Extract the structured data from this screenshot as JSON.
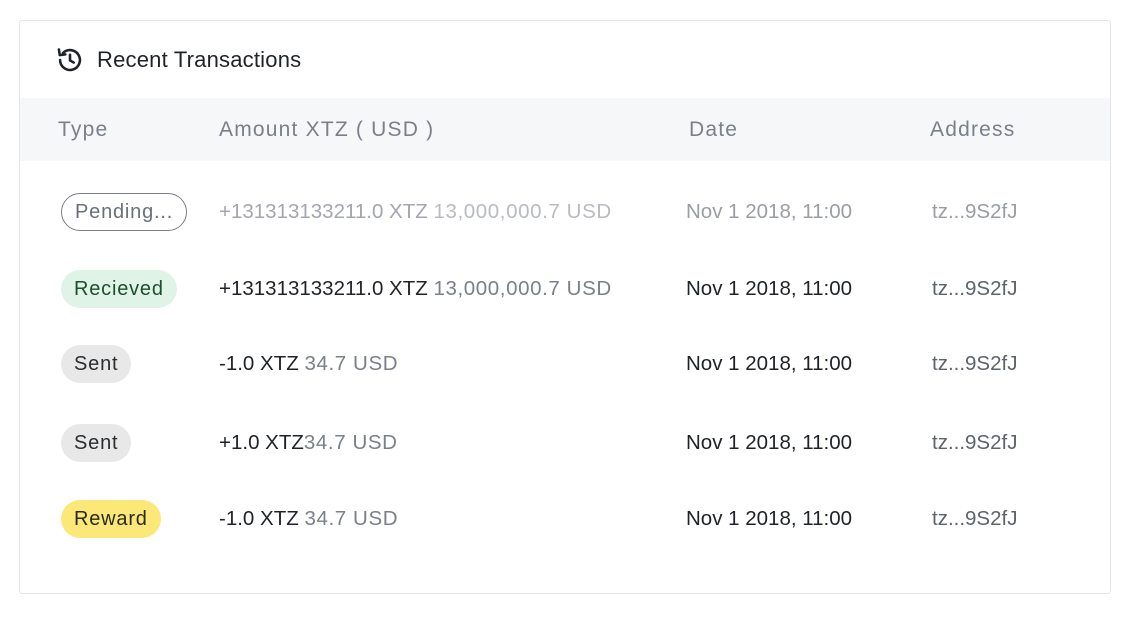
{
  "card": {
    "title": "Recent Transactions",
    "icon": "history-icon"
  },
  "table": {
    "columns": [
      "Type",
      "Amount XTZ ( USD )",
      "Date",
      "Address"
    ],
    "rows": [
      {
        "type": "Pending...",
        "status": "pending",
        "amount_xtz": "+131313133211.0 XTZ",
        "amount_usd": "13,000,000.7 USD",
        "date": "Nov 1 2018, 11:00",
        "address": "tz...9S2fJ"
      },
      {
        "type": "Recieved",
        "status": "received",
        "amount_xtz": "+131313133211.0 XTZ",
        "amount_usd": "13,000,000.7 USD",
        "date": "Nov 1 2018, 11:00",
        "address": "tz...9S2fJ"
      },
      {
        "type": "Sent",
        "status": "sent",
        "amount_xtz": "-1.0 XTZ",
        "amount_usd": "34.7 USD",
        "date": "Nov 1 2018, 11:00",
        "address": "tz...9S2fJ"
      },
      {
        "type": "Sent",
        "status": "sent",
        "amount_xtz": "+1.0 XTZ",
        "amount_usd": "34.7 USD",
        "date": "Nov 1 2018, 11:00",
        "address": "tz...9S2fJ"
      },
      {
        "type": "Reward",
        "status": "reward",
        "amount_xtz": "-1.0 XTZ",
        "amount_usd": "34.7 USD",
        "date": "Nov 1 2018, 11:00",
        "address": "tz...9S2fJ"
      }
    ]
  },
  "colors": {
    "received_badge": "#dff3e7",
    "sent_badge": "#e8e8e8",
    "reward_badge": "#fbe878",
    "header_bg": "#f6f7f9"
  }
}
